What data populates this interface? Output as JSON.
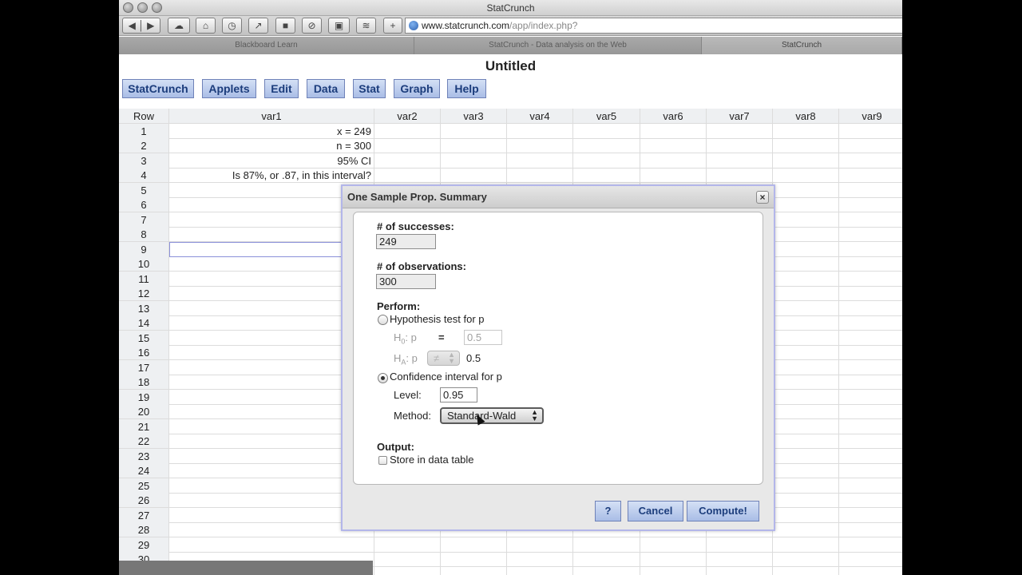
{
  "window": {
    "title": "StatCrunch"
  },
  "browser": {
    "url_host": "www.statcrunch.com",
    "url_path": "/app/index.php?",
    "tabs": [
      {
        "label": "Blackboard Learn"
      },
      {
        "label": "StatCrunch - Data analysis on the Web"
      },
      {
        "label": "StatCrunch"
      }
    ]
  },
  "app": {
    "title": "Untitled",
    "menu": [
      "StatCrunch",
      "Applets",
      "Edit",
      "Data",
      "Stat",
      "Graph",
      "Help"
    ]
  },
  "grid": {
    "row_header": "Row",
    "columns": [
      "var1",
      "var2",
      "var3",
      "var4",
      "var5",
      "var6",
      "var7",
      "var8",
      "var9"
    ],
    "var1_values": [
      "x = 249",
      "n = 300",
      "95% CI",
      "Is 87%, or .87, in this interval?"
    ],
    "row_count": 31,
    "selected_row": 9
  },
  "dialog": {
    "title": "One Sample Prop. Summary",
    "close_glyph": "×",
    "successes_label": "# of successes:",
    "successes_value": "249",
    "observations_label": "# of observations:",
    "observations_value": "300",
    "perform_label": "Perform:",
    "hypothesis_label": "Hypothesis test for p",
    "h0_label": "H0: p",
    "h0_operator": "=",
    "h0_value": "0.5",
    "ha_label": "HA: p",
    "ha_operator": "≠",
    "ha_value": "0.5",
    "ci_label": "Confidence interval for p",
    "level_label": "Level:",
    "level_value": "0.95",
    "method_label": "Method:",
    "method_value": "Standard-Wald",
    "output_label": "Output:",
    "store_label": "Store in data table",
    "help_button": "?",
    "cancel_button": "Cancel",
    "compute_button": "Compute!"
  }
}
